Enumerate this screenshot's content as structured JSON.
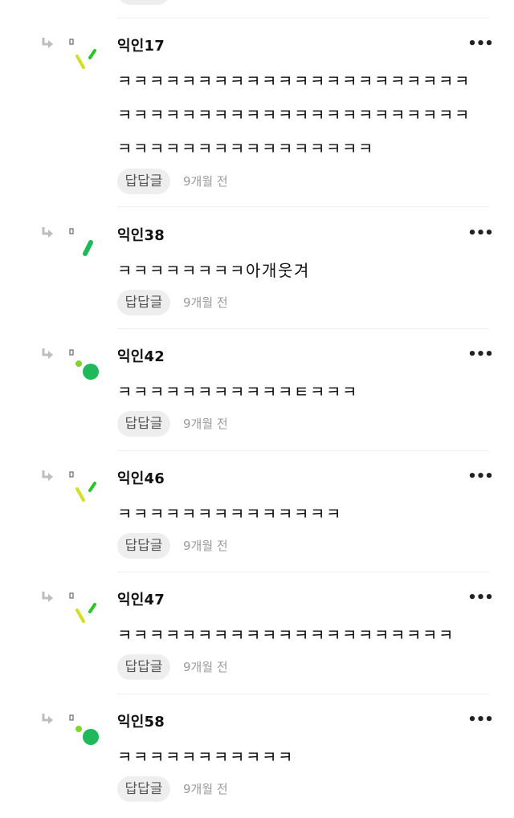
{
  "comments": [
    {
      "author": "익인17",
      "text": "ㅋㅋㅋㅋㅋㅋㅋㅋㅋㅋㅋㅋㅋㅋㅋㅋㅋㅋㅋㅋㅋㅋㅋㅋㅋㅋㅋㅋㅋㅋㅋㅋㅋㅋㅋㅋㅋㅋㅋㅋㅋㅋㅋㅋㅋㅋㅋㅋㅋㅋㅋㅋㅋㅋㅋㅋㅋㅋㅋㅋ",
      "reply_label": "답답글",
      "time": "9개월 전",
      "more_label": "•••",
      "avatar": "avatar-dashes"
    },
    {
      "author": "익인38",
      "text": "ㅋㅋㅋㅋㅋㅋㅋㅋ아개웃겨",
      "reply_label": "답답글",
      "time": "9개월 전",
      "more_label": "•••",
      "avatar": "avatar-bar"
    },
    {
      "author": "익인42",
      "text": "ㅋㅋㅋㅋㅋㅋㅋㅋㅋㅋㅋㅌㅋㅋㅋ",
      "reply_label": "답답글",
      "time": "9개월 전",
      "more_label": "•••",
      "avatar": "avatar-dots"
    },
    {
      "author": "익인46",
      "text": "ㅋㅋㅋㅋㅋㅋㅋㅋㅋㅋㅋㅋㅋㅋ",
      "reply_label": "답답글",
      "time": "9개월 전",
      "more_label": "•••",
      "avatar": "avatar-dashes"
    },
    {
      "author": "익인47",
      "text": "ㅋㅋㅋㅋㅋㅋㅋㅋㅋㅋㅋㅋㅋㅋㅋㅋㅋㅋㅋㅋㅋ",
      "reply_label": "답답글",
      "time": "9개월 전",
      "more_label": "•••",
      "avatar": "avatar-dashes"
    },
    {
      "author": "익인58",
      "text": "ㅋㅋㅋㅋㅋㅋㅋㅋㅋㅋㅋ",
      "reply_label": "답답글",
      "time": "9개월 전",
      "more_label": "•••",
      "avatar": "avatar-dots"
    }
  ],
  "colors": {
    "avatar_yellow": "#d4e01f",
    "avatar_green": "#2bc52b",
    "avatar_dark_green": "#1fb85a",
    "avatar_light_green": "#7fd62a",
    "pill_bg": "#eeeeee",
    "time_text": "#9a9a9a",
    "reply_arrow": "#bdbdbd"
  }
}
